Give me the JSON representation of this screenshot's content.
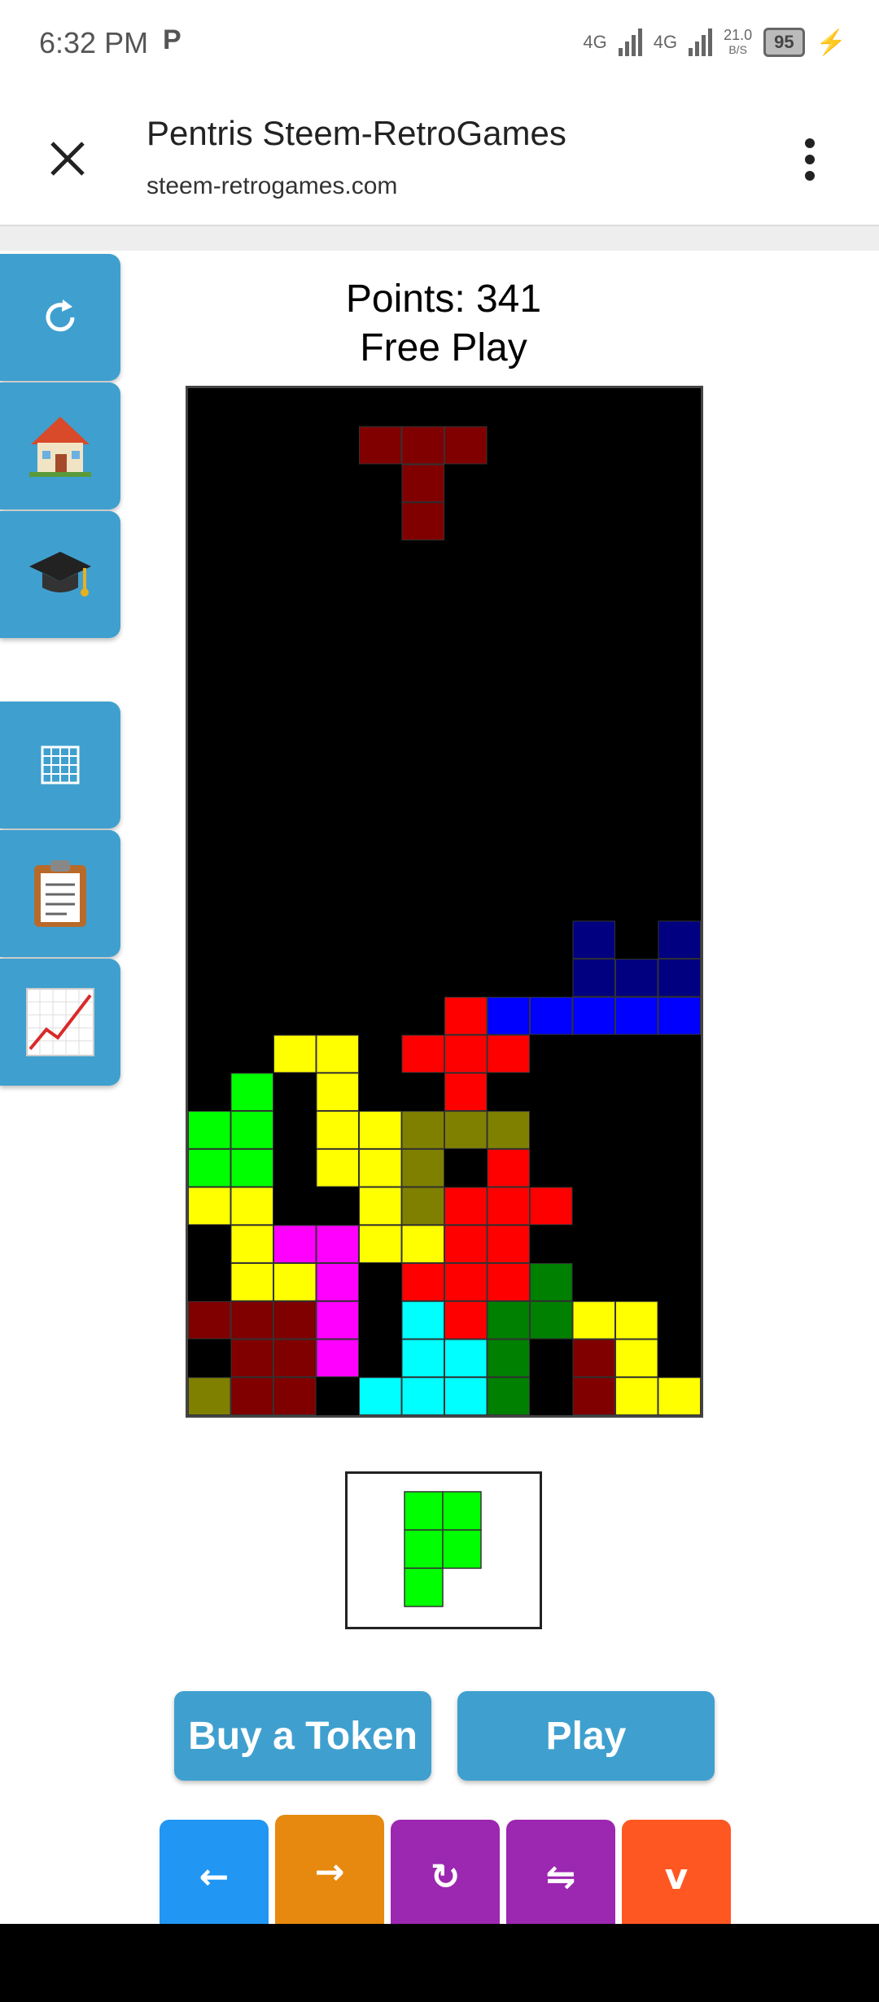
{
  "status_bar": {
    "time": "6:32 PM",
    "app_indicator": "P",
    "network_1": "4G",
    "network_2": "4G",
    "data_rate": "21.0",
    "data_rate_unit": "B/S",
    "battery": "95"
  },
  "browser": {
    "title": "Pentris Steem-RetroGames",
    "url": "steem-retrogames.com"
  },
  "sidebar": {
    "items": [
      {
        "icon": "refresh-icon"
      },
      {
        "icon": "house-icon"
      },
      {
        "icon": "graduation-cap-icon"
      },
      {
        "icon": "grid-icon"
      },
      {
        "icon": "clipboard-icon"
      },
      {
        "icon": "chart-icon"
      }
    ]
  },
  "game": {
    "points_label": "Points: 341",
    "mode_label": "Free Play",
    "board_cols": 12,
    "board_rows": 24,
    "colors": {
      "M": "#800000",
      "R": "#ff0000",
      "Y": "#ffff00",
      "G": "#00ff00",
      "D": "#008000",
      "O": "#808000",
      "C": "#00ffff",
      "P": "#ff00ff",
      "B": "#0000ff",
      "N": "#000080"
    },
    "grid": [
      "............",
      "....MMM.....",
      ".....M......",
      ".....M......",
      "............",
      "............",
      "............",
      "............",
      "............",
      "............",
      "............",
      "............",
      "............",
      "............",
      ".........N.N",
      ".........NNN",
      "......RBBBBB",
      "..YY.RRR....",
      ".G.Y..R.....",
      "GG.YYOOO....",
      "GG.YYO.R....",
      "YY..YORRR...",
      ".YPPYYRR....",
      ".YYP.RRRD...",
      "MMMP.CRDDYY.",
      ".MMP.CCD.MY.",
      "OMM.CCCD.MYY"
    ],
    "next_piece": {
      "color": "#00ff00",
      "cells": [
        [
          0,
          0
        ],
        [
          1,
          0
        ],
        [
          0,
          1
        ],
        [
          1,
          1
        ],
        [
          0,
          2
        ]
      ]
    }
  },
  "buttons": {
    "buy_token": "Buy a Token",
    "play": "Play"
  },
  "controls": [
    {
      "label": "←",
      "color": "#2196f3"
    },
    {
      "label": "→",
      "color": "#e6890e"
    },
    {
      "label": "↻",
      "color": "#9c27b0"
    },
    {
      "label": "⇋",
      "color": "#9c27b0"
    },
    {
      "label": "v",
      "color": "#ff5722"
    }
  ]
}
